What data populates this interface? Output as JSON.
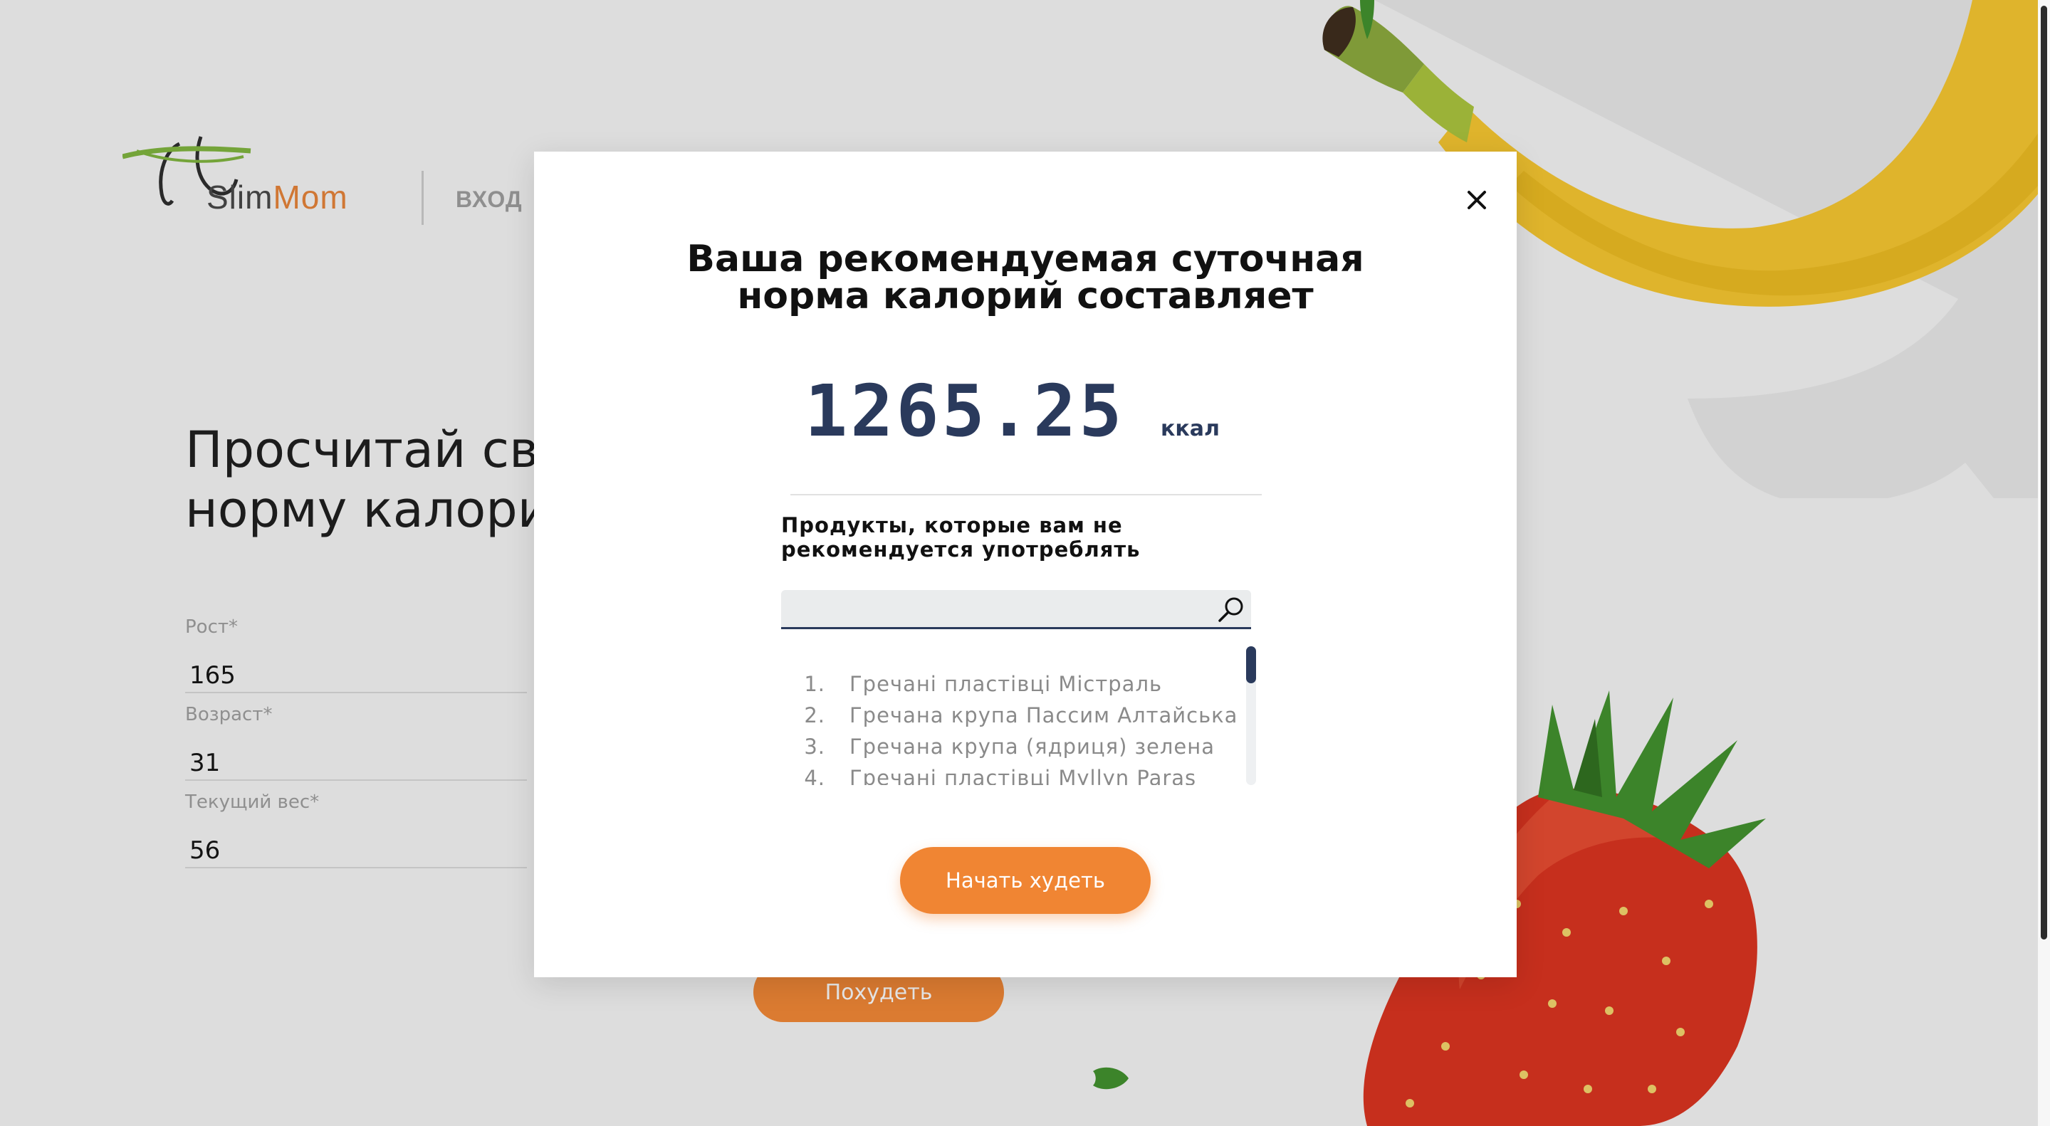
{
  "header": {
    "logo": {
      "part1": "Slim",
      "part2": "Mom"
    },
    "nav_login": "ВХОД"
  },
  "hero": {
    "title_line1": "Просчитай свою суточную",
    "title_line2": "норму калорий прямо сейчас"
  },
  "form": {
    "fields": [
      {
        "label": "Рост*",
        "value": "165"
      },
      {
        "label": "Возраст*",
        "value": "31"
      },
      {
        "label": "Текущий вес*",
        "value": "56"
      }
    ],
    "submit_label": "Похудеть"
  },
  "modal": {
    "title_line1": "Ваша рекомендуемая суточная",
    "title_line2": "норма калорий составляет",
    "kcal_value": "1265.25",
    "kcal_unit": "ккал",
    "products_title_line1": "Продукты, которые вам не",
    "products_title_line2": "рекомендуется употреблять",
    "search": {
      "value": "",
      "placeholder": ""
    },
    "products": [
      {
        "num": "1.",
        "name": "Гречані пластівці Містраль"
      },
      {
        "num": "2.",
        "name": "Гречана крупа Пассим Алтайська"
      },
      {
        "num": "3.",
        "name": "Гречана крупа (ядриця) зелена"
      },
      {
        "num": "4.",
        "name": "Гречані пластівці Myllyn Paras"
      }
    ],
    "cta_label": "Начать худеть"
  },
  "colors": {
    "accent": "#f08533",
    "navy": "#2a3a5c"
  },
  "icons": {
    "close": "close-icon",
    "search": "search-icon",
    "logo": "slimmom-logo-icon"
  }
}
